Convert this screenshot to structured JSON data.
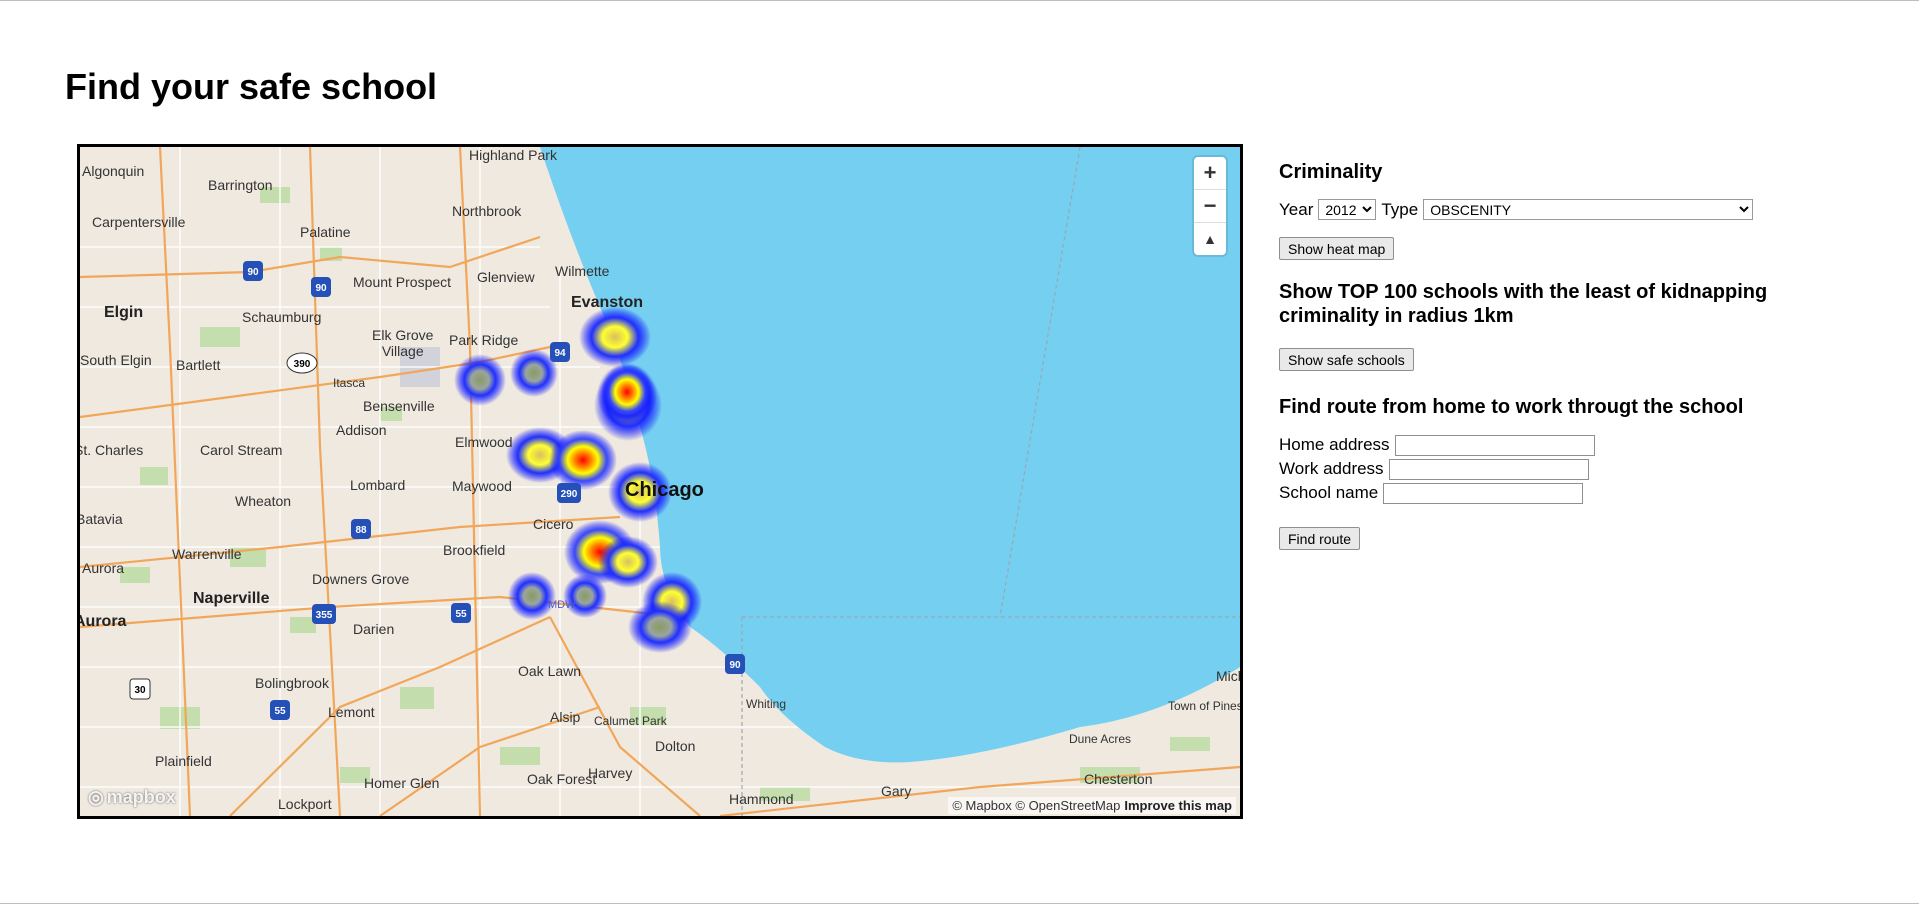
{
  "page": {
    "title": "Find your safe school"
  },
  "map": {
    "labels": {
      "algonquin": "Algonquin",
      "barrington": "Barrington",
      "highland_park": "Highland Park",
      "carpentersville": "Carpentersville",
      "palatine": "Palatine",
      "northbrook": "Northbrook",
      "mount_prospect": "Mount Prospect",
      "glenview": "Glenview",
      "wilmette": "Wilmette",
      "evanston": "Evanston",
      "elgin": "Elgin",
      "schaumburg": "Schaumburg",
      "elk_grove_village": "Elk Grove\nVillage",
      "park_ridge": "Park Ridge",
      "south_elgin": "South Elgin",
      "bartlett": "Bartlett",
      "itasca": "Itasca",
      "bensenville": "Bensenville",
      "addison": "Addison",
      "elmwood": "Elmwood",
      "st_charles": "St. Charles",
      "carol_stream": "Carol Stream",
      "lombard": "Lombard",
      "maywood": "Maywood",
      "chicago": "Chicago",
      "wheaton": "Wheaton",
      "batavia": "Batavia",
      "cicero": "Cicero",
      "brookfield": "Brookfield",
      "warrenville": "Warrenville",
      "aurora": "Aurora",
      "downers_grove": "Downers Grove",
      "naperville": "Naperville",
      "darien": "Darien",
      "aurora2": "Aurora",
      "oak_lawn": "Oak Lawn",
      "bolingbrook": "Bolingbrook",
      "lemont": "Lemont",
      "alsip": "Alsip",
      "calumet_park": "Calumet Park",
      "whiting": "Whiting",
      "dolton": "Dolton",
      "plainfield": "Plainfield",
      "harvey": "Harvey",
      "homer_glen": "Homer Glen",
      "oak_forest": "Oak Forest",
      "lockport": "Lockport",
      "hammond": "Hammond",
      "gary": "Gary",
      "dune_acres": "Dune Acres",
      "chesterton": "Chesterton",
      "town_of_pines": "Town of Pines",
      "michigan_city": "Mich",
      "mdw": "MDW"
    },
    "highways": [
      "90",
      "90",
      "94",
      "390",
      "290",
      "88",
      "355",
      "55",
      "55",
      "30",
      "90"
    ],
    "zoom_in": "+",
    "zoom_out": "−",
    "compass": "▲",
    "logo_text": "mapbox",
    "attribution": "© Mapbox © OpenStreetMap",
    "improve": "Improve this map"
  },
  "criminality": {
    "heading": "Criminality",
    "year_label": "Year",
    "year_value": "2012",
    "type_label": "Type",
    "type_value": "OBSCENITY",
    "show_heat_map": "Show heat map"
  },
  "safe_schools": {
    "heading": "Show TOP 100 schools with the least of kidnapping criminality in radius 1km",
    "button": "Show safe schools"
  },
  "route": {
    "heading": "Find route from home to work througt the school",
    "home_label": "Home address",
    "work_label": "Work address",
    "school_label": "School name",
    "home_value": "",
    "work_value": "",
    "school_value": "",
    "button": "Find route"
  },
  "colors": {
    "water": "#75cff0",
    "land": "#efe9e0",
    "heat_low": "#1a1aff",
    "heat_mid": "#ffff00",
    "heat_high": "#ff0000"
  }
}
